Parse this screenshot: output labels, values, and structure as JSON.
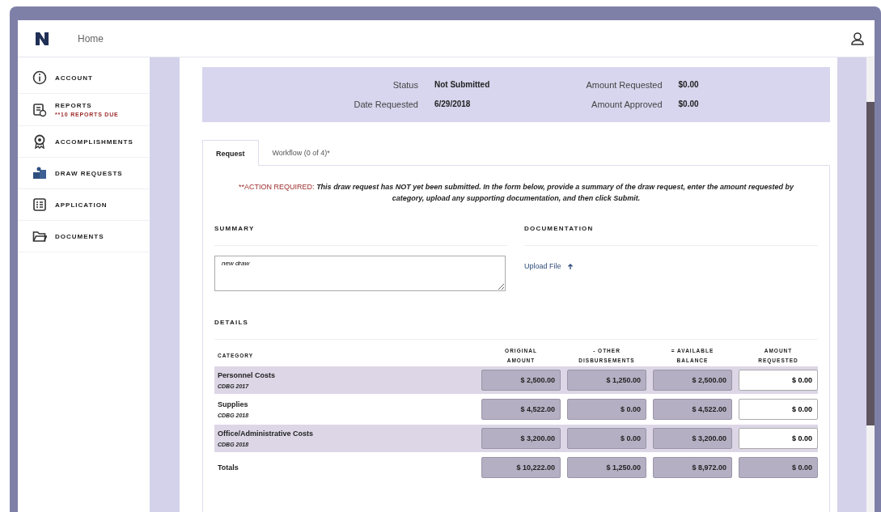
{
  "header": {
    "title": "Home"
  },
  "sidebar": {
    "items": [
      {
        "label": "ACCOUNT"
      },
      {
        "label": "REPORTS",
        "alert": "**10 REPORTS DUE"
      },
      {
        "label": "ACCOMPLISHMENTS"
      },
      {
        "label": "DRAW REQUESTS"
      },
      {
        "label": "APPLICATION"
      },
      {
        "label": "DOCUMENTS"
      }
    ]
  },
  "summary_band": {
    "fields": [
      {
        "label": "Status",
        "value": "Not Submitted"
      },
      {
        "label": "Amount Requested",
        "value": "$0.00"
      },
      {
        "label": "Date Requested",
        "value": "6/29/2018"
      },
      {
        "label": "Amount Approved",
        "value": "$0.00"
      }
    ]
  },
  "tabs": [
    {
      "label": "Request",
      "selected": true
    },
    {
      "label": "Workflow (0 of 4)*",
      "selected": false
    }
  ],
  "notice": {
    "label": "**ACTION REQUIRED:",
    "text": "This draw request has NOT yet been submitted.  In the form below, provide a summary of the draw request, enter the amount requested by category, upload any supporting documentation, and then click Submit."
  },
  "summary": {
    "heading": "SUMMARY",
    "value": "new draw"
  },
  "documentation": {
    "heading": "DOCUMENTATION",
    "link": "Upload File"
  },
  "details": {
    "heading": "DETAILS",
    "columns": [
      "CATEGORY",
      "ORIGINAL AMOUNT",
      "- OTHER DISBURSEMENTS",
      "= AVAILABLE BALANCE",
      "AMOUNT REQUESTED"
    ],
    "rows": [
      {
        "kind": "line",
        "category": "Personnel Costs",
        "fund": "CDBG 2017",
        "values": [
          "$ 2,500.00",
          "$ 1,250.00",
          "$ 2,500.00",
          "$ 0.00"
        ]
      },
      {
        "kind": "line",
        "category": "Supplies",
        "fund": "CDBG 2018",
        "values": [
          "$ 4,522.00",
          "$ 0.00",
          "$ 4,522.00",
          "$ 0.00"
        ]
      },
      {
        "kind": "line",
        "category": "Office/Administrative Costs",
        "fund": "CDBG 2018",
        "values": [
          "$ 3,200.00",
          "$ 0.00",
          "$ 3,200.00",
          "$ 0.00"
        ]
      },
      {
        "kind": "total",
        "category": "Totals",
        "values": [
          "$ 10,222.00",
          "$ 1,250.00",
          "$ 8,972.00",
          "$ 0.00"
        ]
      }
    ]
  }
}
